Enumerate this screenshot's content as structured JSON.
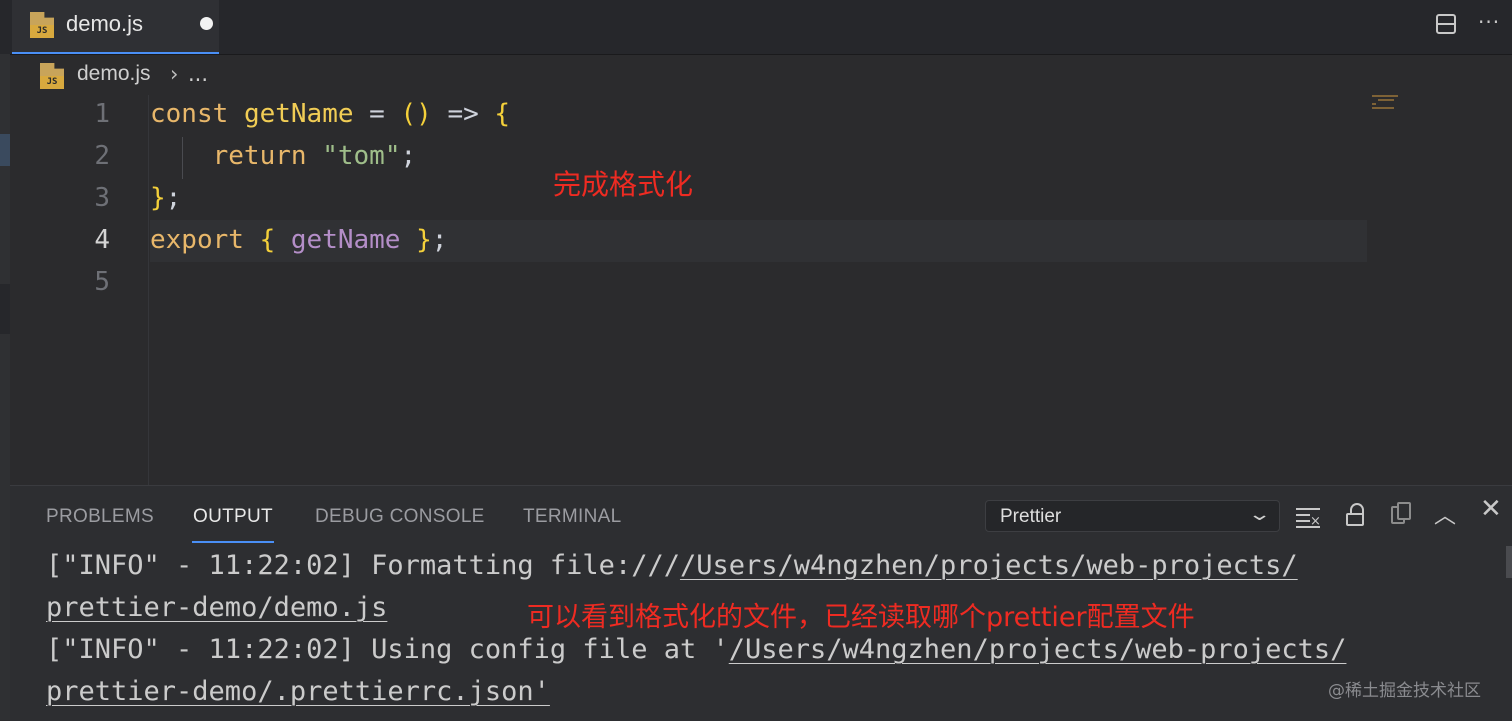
{
  "tab": {
    "label": "demo.js",
    "icon_text": "JS"
  },
  "breadcrumb": {
    "file": "demo.js",
    "separator": "›",
    "more": "..."
  },
  "editor": {
    "line_numbers": [
      "1",
      "2",
      "3",
      "4",
      "5"
    ],
    "current_line": 4,
    "lines": {
      "l1": {
        "kw": "const",
        "fn": "getName",
        "eq": " = ",
        "paren": "()",
        "arrow": " => ",
        "brace": "{"
      },
      "l2": {
        "kw": "return",
        "str": "\"tom\"",
        "semi": ";"
      },
      "l3": {
        "brace": "}",
        "semi": ";"
      },
      "l4": {
        "kw": "export",
        "brace_open": "{",
        "name": "getName",
        "brace_close": "}",
        "semi": ";"
      }
    },
    "annotation": "完成格式化"
  },
  "panel": {
    "tabs": [
      "PROBLEMS",
      "OUTPUT",
      "DEBUG CONSOLE",
      "TERMINAL"
    ],
    "active_tab": "OUTPUT",
    "channel": "Prettier",
    "output": {
      "line1_prefix": "[\"INFO\" - 11:22:02] Formatting file:///",
      "line1_link": "/Users/w4ngzhen/projects/web-projects/",
      "line2_link": "prettier-demo/demo.js",
      "line3_prefix": "[\"INFO\" - 11:22:02] Using config file at '",
      "line3_link": "/Users/w4ngzhen/projects/web-projects/",
      "line4_link": "prettier-demo/.prettierrc.json'"
    },
    "annotation": "可以看到格式化的文件，已经读取哪个prettier配置文件"
  },
  "watermark": "@稀土掘金技术社区",
  "colors": {
    "accent": "#4a8ff5",
    "annotation": "#ee2b22",
    "keyword": "#e8b76a",
    "string": "#9fbe8a"
  },
  "icons": [
    "js-file-icon",
    "dirty-dot-icon",
    "split-editor-icon",
    "more-actions-icon",
    "chevron-down-icon",
    "clear-output-icon",
    "lock-icon",
    "copy-icon",
    "chevron-up-icon",
    "close-icon"
  ]
}
